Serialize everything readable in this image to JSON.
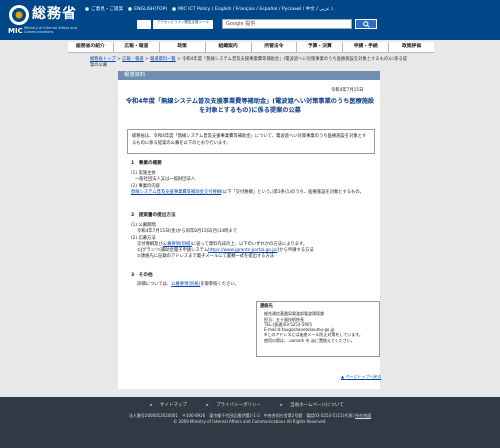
{
  "header": {
    "logo_title": "総務省",
    "logo_mic": "MIC",
    "logo_sub": "Ministry of Internal Affairs and Communications",
    "links": [
      {
        "label": "ご意見・ご提案"
      },
      {
        "label": "ENGLISH(TOP)"
      },
      {
        "label": "MIC ICT Policy ( English / Français / Español / Русский / 中文 / عربي )"
      }
    ],
    "a11y_label": "アクセシビリティ閲覧支援ツール",
    "search_placeholder": "Google 提供",
    "accent": "#004789"
  },
  "nav": [
    "総務省の紹介",
    "広報・報道",
    "政策",
    "組織案内",
    "所管法令",
    "予算・決算",
    "申請・手続",
    "政策評価"
  ],
  "breadcrumb": {
    "items": [
      "総務省トップ",
      "広報・報道",
      "報道資料一覧"
    ],
    "current": "令和4年度「無線システム普及支援事業費等補助金」(電波遮へい対策事業のうち医療施設を対象とするもの)に係る提案の公募"
  },
  "section_heading": "報道資料",
  "date": "令和4年7月15日",
  "title": "令和4年度「無線システム普及支援事業費等補助金」(電波遮へい対策事業のうち医療施設を対象とするもの)に係る提案の公募",
  "intro": "総務省は、令和4年度「無線システム普及支援事業費等補助金」について、電波遮へい対策事業のうち医療施設を対象とするものに係る提案の公募を以下のとおり行います。",
  "s1": {
    "heading": "1　事業の概要",
    "i1": "(1) 実施主体",
    "i1_text": "一般社団法人又は一般財団法人",
    "i2": "(2) 事業の内容",
    "link": "無線システム普及支援事業費等補助金交付要綱",
    "i2_text": "(以下「交付要綱」という。)第3条(1)のうち、医療施設を対象とするもの。"
  },
  "s2": {
    "heading": "2　提案書の提出方法",
    "i1": "(1) 公募期間",
    "i1_text": "令和4年7月15日(金)から同年8月15日(月)14時まで",
    "i2": "(2) 応募方法",
    "i2_pre": "交付要綱及び",
    "i2_link": "公募要領(別紙)",
    "i2_post": "に従って資料作成の上、以下のいずれかの方法によります。",
    "m1_pre": "①Jグランツ(補助金電子申請システム",
    "m1_link": "https://www.jgrants-portal.go.jp/",
    "m1_post": ")から申請する方法",
    "m2": "②連絡先に記載のアドレスまで電子メールにて書類一式を提出する方法"
  },
  "s3": {
    "heading": "3　その他",
    "pre": "詳細については、",
    "link": "公募要領(別紙)",
    "post": "を御参照ください。"
  },
  "contact": {
    "heading": "連絡先",
    "lines": [
      "総合通信基盤局電波部電波環境課",
      "担当：五十嵐技術係長",
      "TEL:(直通)03-5253-5905",
      "E-mail:d-tougoshanetokoumu-go.jp",
      "※このアドレスには迷惑メール防止対策をしています。",
      "使用の際は、.oomark を.@に置換えてください。"
    ]
  },
  "page_top": "ページトップへ戻る",
  "footer": {
    "links": [
      "サイトマップ",
      "プライバシーポリシー",
      "当省ホームページについて"
    ],
    "info1": "法人番号2000012020001　〒100-8926　東京都千代田区霞が関2-1-2　中央合同庁舎第2号館　電話03-5253-5111(代表)",
    "access": "所在地図",
    "copyright": "© 2009 Ministry of Internal Affairs and Communications All Rights Reserved."
  }
}
